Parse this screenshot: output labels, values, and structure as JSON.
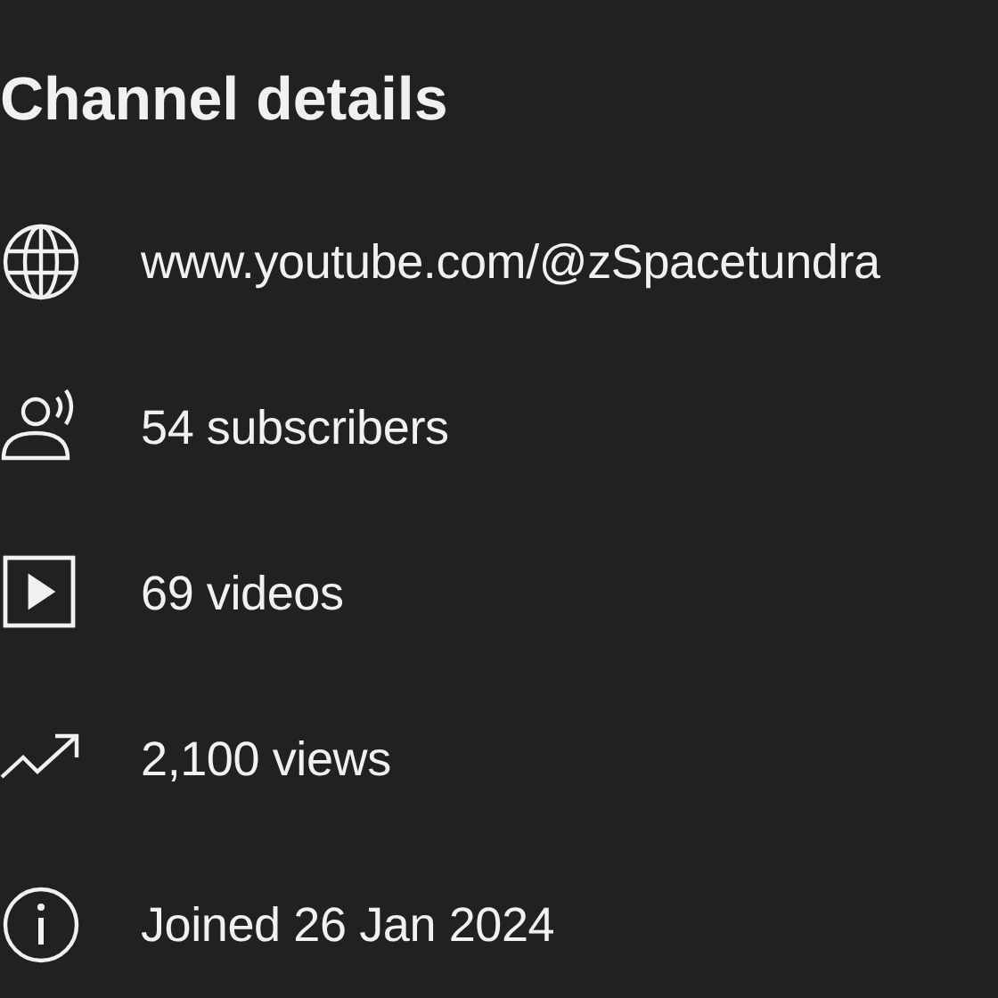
{
  "title": "Channel details",
  "details": [
    {
      "kind": "link",
      "text": "www.youtube.com/@zSpacetundra"
    },
    {
      "kind": "subscribers",
      "text": "54 subscribers"
    },
    {
      "kind": "videos",
      "text": "69 videos"
    },
    {
      "kind": "views",
      "text": "2,100 views"
    },
    {
      "kind": "joined",
      "text": "Joined 26 Jan 2024"
    }
  ]
}
